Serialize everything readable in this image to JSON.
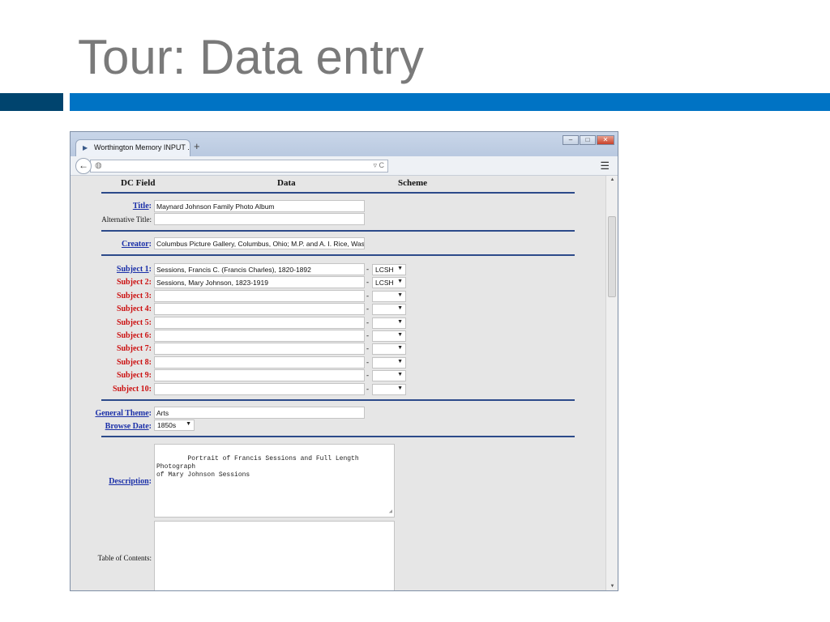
{
  "slide": {
    "title": "Tour: Data entry"
  },
  "browser": {
    "tab_title": "Worthington Memory INPUT ...",
    "new_tab": "+",
    "window_buttons": {
      "minimize": "–",
      "maximize": "□",
      "close": "✕"
    },
    "back": "←",
    "url_icon": "globe-icon",
    "url_right": "▿ C"
  },
  "form": {
    "headers": {
      "field": "DC Field",
      "data": "Data",
      "scheme": "Scheme"
    },
    "title_label": "Title",
    "title_value": "Maynard Johnson Family Photo Album",
    "alt_title_label": "Alternative Title:",
    "alt_title_value": "",
    "creator_label": "Creator",
    "creator_value": "Columbus Picture Gallery, Columbus, Ohio; M.P. and A. I. Rice, Washi",
    "subjects": [
      {
        "label": "Subject 1",
        "value": "Sessions, Francis C. (Francis Charles), 1820-1892",
        "scheme": "LCSH"
      },
      {
        "label": "Subject 2:",
        "value": "Sessions, Mary Johnson, 1823-1919",
        "scheme": "LCSH"
      },
      {
        "label": "Subject 3:",
        "value": "",
        "scheme": ""
      },
      {
        "label": "Subject 4:",
        "value": "",
        "scheme": ""
      },
      {
        "label": "Subject 5:",
        "value": "",
        "scheme": ""
      },
      {
        "label": "Subject 6:",
        "value": "",
        "scheme": ""
      },
      {
        "label": "Subject 7:",
        "value": "",
        "scheme": ""
      },
      {
        "label": "Subject 8:",
        "value": "",
        "scheme": ""
      },
      {
        "label": "Subject 9:",
        "value": "",
        "scheme": ""
      },
      {
        "label": "Subject 10:",
        "value": "",
        "scheme": ""
      }
    ],
    "dash": "-",
    "theme_label": "General Theme",
    "theme_value": "Arts",
    "browse_label": "Browse Date",
    "browse_value": "1850s",
    "description_label": "Description",
    "description_value": "Portrait of Francis Sessions and Full Length Photograph\nof Mary Johnson Sessions",
    "toc_label": "Table of Contents:",
    "toc_value": ""
  },
  "colors": {
    "bar_dark": "#00446e",
    "bar_light": "#0073c4",
    "link_blue": "#1a2fa8",
    "required_red": "#cc1111"
  }
}
